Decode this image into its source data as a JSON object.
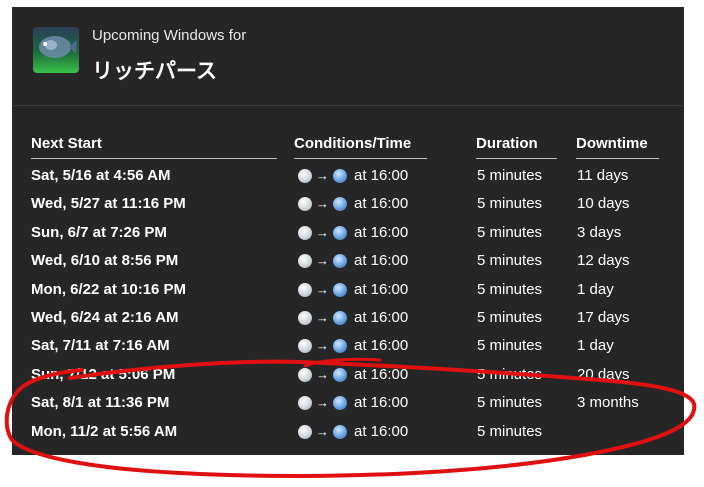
{
  "header": {
    "subtitle": "Upcoming Windows for",
    "title": "リッチパース",
    "icon": "fish-icon"
  },
  "columns": [
    "Next Start",
    "Conditions/Time",
    "Duration",
    "Downtime"
  ],
  "condition_icons": {
    "from": "fair-weather-icon",
    "arrow": "→",
    "to": "rain-icon"
  },
  "rows": [
    {
      "start": "Sat, 5/16 at 4:56 AM",
      "time": "at 16:00",
      "duration": "5 minutes",
      "downtime": "11 days"
    },
    {
      "start": "Wed, 5/27 at 11:16 PM",
      "time": "at 16:00",
      "duration": "5 minutes",
      "downtime": "10 days"
    },
    {
      "start": "Sun, 6/7 at 7:26 PM",
      "time": "at 16:00",
      "duration": "5 minutes",
      "downtime": "3 days"
    },
    {
      "start": "Wed, 6/10 at 8:56 PM",
      "time": "at 16:00",
      "duration": "5 minutes",
      "downtime": "12 days"
    },
    {
      "start": "Mon, 6/22 at 10:16 PM",
      "time": "at 16:00",
      "duration": "5 minutes",
      "downtime": "1 day"
    },
    {
      "start": "Wed, 6/24 at 2:16 AM",
      "time": "at 16:00",
      "duration": "5 minutes",
      "downtime": "17 days"
    },
    {
      "start": "Sat, 7/11 at 7:16 AM",
      "time": "at 16:00",
      "duration": "5 minutes",
      "downtime": "1 day"
    },
    {
      "start": "Sun, 7/12 at 5:06 PM",
      "time": "at 16:00",
      "duration": "5 minutes",
      "downtime": "20 days"
    },
    {
      "start": "Sat, 8/1 at 11:36 PM",
      "time": "at 16:00",
      "duration": "5 minutes",
      "downtime": "3 months"
    },
    {
      "start": "Mon, 11/2 at 5:56 AM",
      "time": "at 16:00",
      "duration": "5 minutes",
      "downtime": ""
    }
  ],
  "colors": {
    "panel": "#262626",
    "text": "#ffffff",
    "annotation": "#e01010"
  }
}
